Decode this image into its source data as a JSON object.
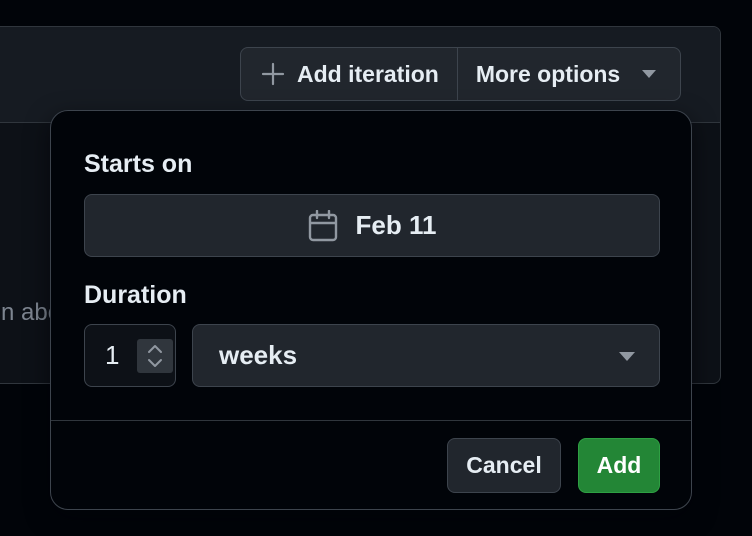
{
  "background": {
    "partial_text": "n abo"
  },
  "toolbar": {
    "add_iteration_label": "Add iteration",
    "more_options_label": "More options",
    "add_icon": "plus-icon",
    "more_icon": "caret-down-icon"
  },
  "popover": {
    "starts_on_label": "Starts on",
    "start_date": "Feb 11",
    "date_icon": "calendar-icon",
    "duration_label": "Duration",
    "duration_value": "1",
    "duration_unit": "weeks",
    "duration_unit_options_visible": [
      "weeks"
    ],
    "cancel_label": "Cancel",
    "add_label": "Add"
  },
  "colors": {
    "primary_button": "#238636",
    "surface": "#21262d",
    "border": "#3d444d",
    "text": "#e6edf3"
  }
}
